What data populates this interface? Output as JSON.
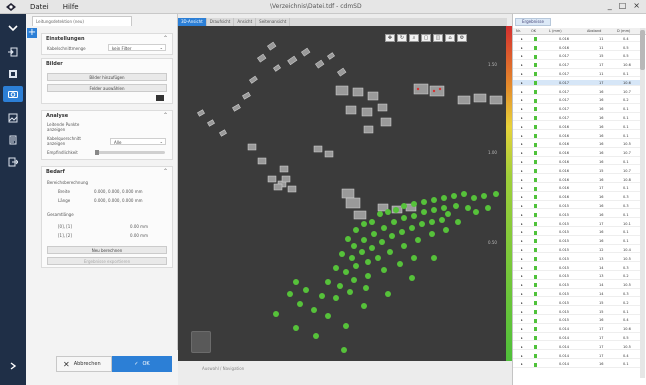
{
  "titlebar": {
    "menus": [
      "Datei",
      "Hilfe"
    ],
    "window_title": "\\Verzeichnis\\Datei.tdf - cdmSD",
    "controls": [
      "_",
      "□",
      "×"
    ]
  },
  "left_toolbar": {
    "icons": [
      "collapse-chevron-icon",
      "import-icon",
      "layers-icon",
      "camera-icon",
      "image-icon",
      "report-icon",
      "export-icon",
      "expand-arrow-icon"
    ],
    "active_index": 3
  },
  "panel": {
    "tab_label": "Leitungsdetektion (neu)",
    "add_label": "+",
    "sections": {
      "settings": {
        "title": "Einstellungen",
        "filter_label": "Kabelschnittmenge",
        "filter_value": "kein Filter"
      },
      "images": {
        "title": "Bilder",
        "btn_show": "Bilder hinzufügen",
        "btn_fields": "Felder auswählen"
      },
      "analysis": {
        "title": "Analyse",
        "line1": "Leitende Punkte",
        "line2": "anzeigen",
        "line3": "Kabelquerschnitt",
        "line4": "anzeigen",
        "select_value": "Alle",
        "slider_label": "Empfindlichkeit"
      },
      "result": {
        "title": "Bedarf",
        "sub": "Bereichsberechnung",
        "r1_label": "Breite",
        "r1_value": "0.000, 0.000, 0.000 mm",
        "r2_label": "Länge",
        "r2_value": "0.000, 0.000, 0.000 mm",
        "sub2": "Gesamtlänge",
        "r3_label": "[0], [1]",
        "r3_value": "0.00 mm",
        "r4_label": "[1], [2]",
        "r4_value": "0.00 mm",
        "btn_calc": "Neu berechnen",
        "btn_export": "Ergebnisse exportieren"
      }
    },
    "cancel_label": "Abbrechen",
    "ok_label": "OK"
  },
  "viewport": {
    "tabs": [
      "3D-Ansicht",
      "Draufsicht",
      "Ansicht",
      "Seitenansicht"
    ],
    "active_tab": 0,
    "tool_icons": [
      "move-icon",
      "rotate-icon",
      "zoom-icon",
      "fit-icon",
      "select-icon",
      "home-icon",
      "settings-icon"
    ],
    "scale_ticks": [
      "1.50",
      "1.00",
      "0.50"
    ],
    "status_text": "Auswahl / Navigation"
  },
  "table": {
    "tab_label": "Ergebnisse",
    "columns": [
      "Nr.",
      "OK",
      "L (mm)",
      "Abstand",
      "D (mm)"
    ],
    "rows": [
      [
        "1",
        "0.016",
        "11",
        "0.4"
      ],
      [
        "2",
        "0.016",
        "11",
        "0.5"
      ],
      [
        "3",
        "0.017",
        "15",
        "0.5"
      ],
      [
        "4",
        "0.017",
        "17",
        "10.6"
      ],
      [
        "5",
        "0.017",
        "11",
        "0.1"
      ],
      [
        "6",
        "0.017",
        "17",
        "10.6"
      ],
      [
        "7",
        "0.017",
        "16",
        "10.7"
      ],
      [
        "8",
        "0.017",
        "16",
        "0.2"
      ],
      [
        "9",
        "0.017",
        "16",
        "0.1"
      ],
      [
        "10",
        "0.017",
        "16",
        "0.1"
      ],
      [
        "11",
        "0.016",
        "16",
        "0.1"
      ],
      [
        "12",
        "0.016",
        "16",
        "0.1"
      ],
      [
        "13",
        "0.016",
        "16",
        "10.5"
      ],
      [
        "14",
        "0.016",
        "16",
        "10.7"
      ],
      [
        "15",
        "0.016",
        "16",
        "0.1"
      ],
      [
        "16",
        "0.016",
        "15",
        "10.7"
      ],
      [
        "17",
        "0.016",
        "16",
        "10.8"
      ],
      [
        "18",
        "0.016",
        "17",
        "0.1"
      ],
      [
        "19",
        "0.016",
        "16",
        "0.3"
      ],
      [
        "20",
        "0.015",
        "16",
        "0.3"
      ],
      [
        "21",
        "0.015",
        "16",
        "0.1"
      ],
      [
        "22",
        "0.015",
        "17",
        "10.1"
      ],
      [
        "23",
        "0.015",
        "16",
        "0.1"
      ],
      [
        "24",
        "0.015",
        "16",
        "0.1"
      ],
      [
        "25",
        "0.015",
        "12",
        "10.4"
      ],
      [
        "26",
        "0.015",
        "13",
        "10.5"
      ],
      [
        "27",
        "0.015",
        "14",
        "0.3"
      ],
      [
        "28",
        "0.015",
        "13",
        "0.2"
      ],
      [
        "29",
        "0.015",
        "14",
        "10.5"
      ],
      [
        "30",
        "0.015",
        "14",
        "0.3"
      ],
      [
        "31",
        "0.015",
        "15",
        "0.2"
      ],
      [
        "32",
        "0.015",
        "15",
        "0.1"
      ],
      [
        "33",
        "0.015",
        "16",
        "0.4"
      ],
      [
        "34",
        "0.014",
        "17",
        "10.6"
      ],
      [
        "35",
        "0.014",
        "17",
        "0.5"
      ],
      [
        "36",
        "0.014",
        "17",
        "10.5"
      ],
      [
        "37",
        "0.014",
        "17",
        "0.4"
      ],
      [
        "38",
        "0.014",
        "16",
        "0.1"
      ]
    ],
    "selected_row": 5
  }
}
